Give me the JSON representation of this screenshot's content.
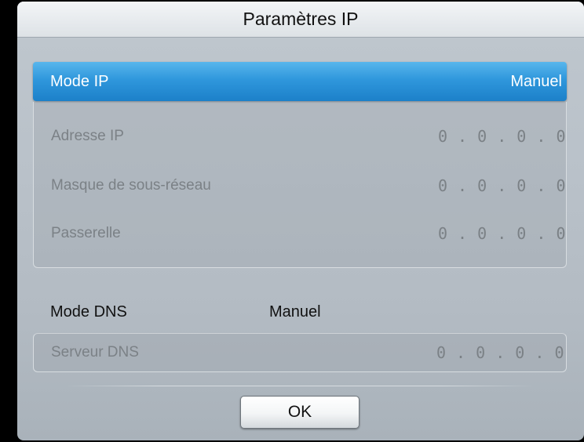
{
  "dialog": {
    "title": "Paramètres IP",
    "ip_mode": {
      "label": "Mode IP",
      "value": "Manuel"
    },
    "ip_fields": [
      {
        "label": "Adresse IP",
        "value": "0 . 0 . 0 . 0"
      },
      {
        "label": "Masque de sous-réseau",
        "value": "0 . 0 . 0 . 0"
      },
      {
        "label": "Passerelle",
        "value": "0 . 0 . 0 . 0"
      }
    ],
    "dns_mode": {
      "label": "Mode DNS",
      "value": "Manuel"
    },
    "dns_server": {
      "label": "Serveur DNS",
      "value": "0 . 0 . 0 . 0"
    },
    "ok_label": "OK"
  },
  "colors": {
    "selection_blue": "#2f97dc",
    "panel_gray": "#b9c1c9",
    "disabled_text": "#7b8186"
  }
}
